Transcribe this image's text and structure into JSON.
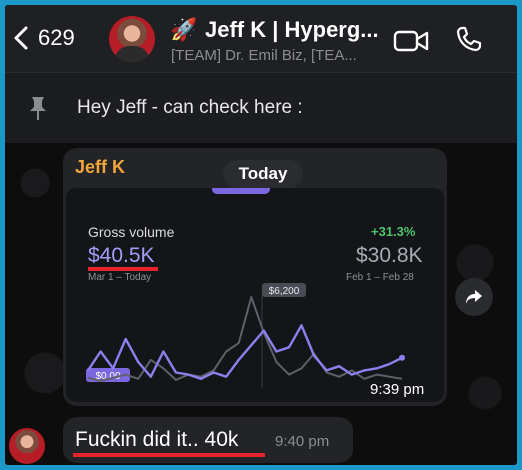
{
  "header": {
    "back_count": "629",
    "rocket_emoji": "🚀",
    "title": "Jeff K | Hyperg...",
    "subtitle": "[TEAM] Dr. Emil Biz, [TEA..."
  },
  "pinned": {
    "text": "Hey Jeff - can check here :"
  },
  "date_pill": "Today",
  "message1": {
    "sender": "Jeff K",
    "time": "9:39 pm",
    "screenshot": {
      "gross_volume_label": "Gross volume",
      "change": "+31.3%",
      "value": "$40.5K",
      "compare_value": "$30.8K",
      "period": "Mar 1 – Today",
      "compare_period": "Feb 1 – Feb 28",
      "peak_label": "$6,200",
      "min_label": "$0.00"
    }
  },
  "message2": {
    "text": "Fuckin did it.. 40k",
    "time": "9:40 pm"
  },
  "colors": {
    "accent_purple": "#a69af6",
    "positive_green": "#4fc36a",
    "sender_orange": "#f1a53a",
    "highlight_red": "#e4232a"
  },
  "chart_data": {
    "type": "line",
    "series": [
      {
        "values": [
          12,
          30,
          14,
          42,
          20,
          6,
          30,
          10,
          8,
          4,
          10,
          6,
          22,
          36,
          50,
          30,
          34,
          55,
          26,
          12,
          16,
          8,
          12,
          14,
          18,
          24
        ]
      },
      {
        "values": [
          5,
          2,
          5,
          8,
          4,
          22,
          14,
          3,
          8,
          6,
          12,
          30,
          38,
          82,
          48,
          20,
          8,
          14,
          28,
          10,
          6,
          12,
          4,
          8,
          6,
          4
        ]
      }
    ]
  }
}
